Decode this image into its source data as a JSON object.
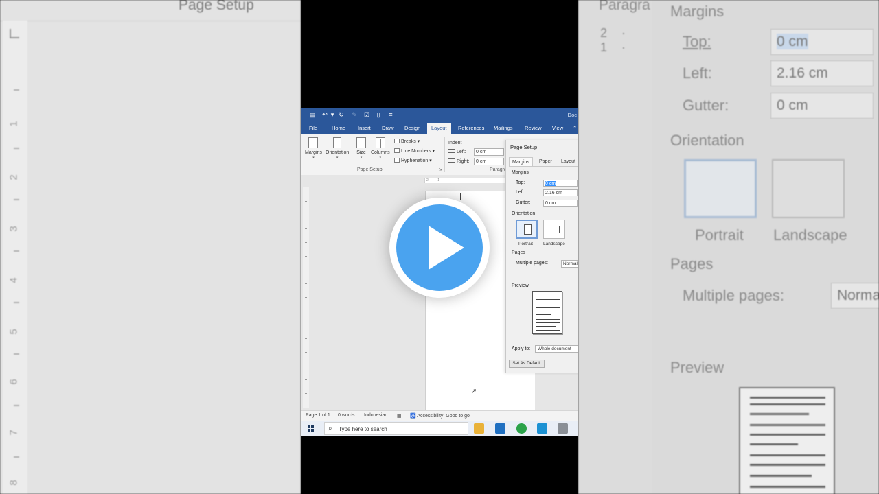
{
  "colors": {
    "word_blue": "#2b579a",
    "play_blue": "#4aa3ef",
    "selection": "#3390ff"
  },
  "background_zoom": {
    "left_title": "Page Setup",
    "right_strip_title": "Paragra",
    "right_strip_nums": "2 · 1 ·",
    "ruler_numbers": [
      "1",
      "2",
      "3",
      "4",
      "5",
      "6",
      "7",
      "8"
    ],
    "margins_heading": "Margins",
    "top_label": "Top:",
    "top_value": "0 cm",
    "left_label": "Left:",
    "left_value": "2.16 cm",
    "gutter_label": "Gutter:",
    "gutter_value": "0 cm",
    "orientation_heading": "Orientation",
    "portrait": "Portrait",
    "landscape": "Landscape",
    "pages_heading": "Pages",
    "multiple_pages": "Multiple pages:",
    "multiple_pages_value": "Norma",
    "preview_heading": "Preview"
  },
  "word": {
    "titlebar": {
      "doc_name": "Doc",
      "icons": [
        "save-icon",
        "undo-icon",
        "redo-icon",
        "brush-icon",
        "checklist-icon",
        "new-doc-icon",
        "customize-icon"
      ]
    },
    "tabs": [
      "File",
      "Home",
      "Insert",
      "Draw",
      "Design",
      "Layout",
      "References",
      "Mailings",
      "Review",
      "View"
    ],
    "active_tab": "Layout",
    "ribbon": {
      "margins": "Margins",
      "orientation": "Orientation",
      "size": "Size",
      "columns": "Columns",
      "breaks": "Breaks",
      "line_numbers": "Line Numbers",
      "hyphenation": "Hyphenation",
      "page_setup_group": "Page Setup",
      "indent_label": "Indent",
      "indent_left_label": "Left:",
      "indent_left_value": "0 cm",
      "indent_right_label": "Right:",
      "indent_right_value": "0 cm",
      "paragraph_group": "Paragra"
    },
    "ruler_text": "2 · · 1 · · ·",
    "status": {
      "page": "Page 1 of 1",
      "words": "0 words",
      "language": "Indonesian",
      "accessibility": "Accessibility: Good to go"
    },
    "taskbar": {
      "search_placeholder": "Type here to search"
    }
  },
  "dialog": {
    "title": "Page Setup",
    "tabs": [
      "Margins",
      "Paper",
      "Layout"
    ],
    "active_tab": "Margins",
    "margins_section": "Margins",
    "top_label": "Top:",
    "top_value": "0 cm",
    "left_label": "Left:",
    "left_value": "2.16 cm",
    "gutter_label": "Gutter:",
    "gutter_value": "0 cm",
    "orientation_section": "Orientation",
    "portrait": "Portrait",
    "landscape": "Landscape",
    "pages_section": "Pages",
    "multiple_pages": "Multiple pages:",
    "multiple_pages_value": "Normal",
    "preview_section": "Preview",
    "apply_to": "Apply to:",
    "apply_to_value": "Whole document",
    "set_default": "Set As Default"
  }
}
